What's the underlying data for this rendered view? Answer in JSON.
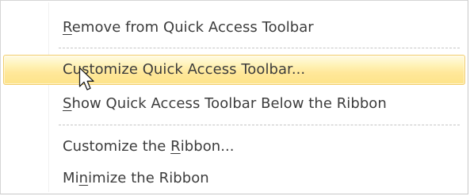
{
  "context_menu": {
    "items": [
      {
        "before": "",
        "key": "R",
        "after": "emove from Quick Access Toolbar"
      },
      {
        "before": "Cu",
        "key": "s",
        "after": "tomize Quick Access Toolbar...",
        "highlighted": true
      },
      {
        "before": "",
        "key": "S",
        "after": "how Quick Access Toolbar Below the Ribbon"
      },
      {
        "before": "Customize the ",
        "key": "R",
        "after": "ibbon..."
      },
      {
        "before": "Mi",
        "key": "n",
        "after": "imize the Ribbon"
      }
    ]
  },
  "colors": {
    "highlight_top": "#fffbe4",
    "highlight_bottom": "#fde389",
    "highlight_border": "#f2cd6b",
    "text": "#3c3c3c",
    "separator": "#c6c6c6"
  },
  "cursor_icon": "mouse-pointer-icon"
}
